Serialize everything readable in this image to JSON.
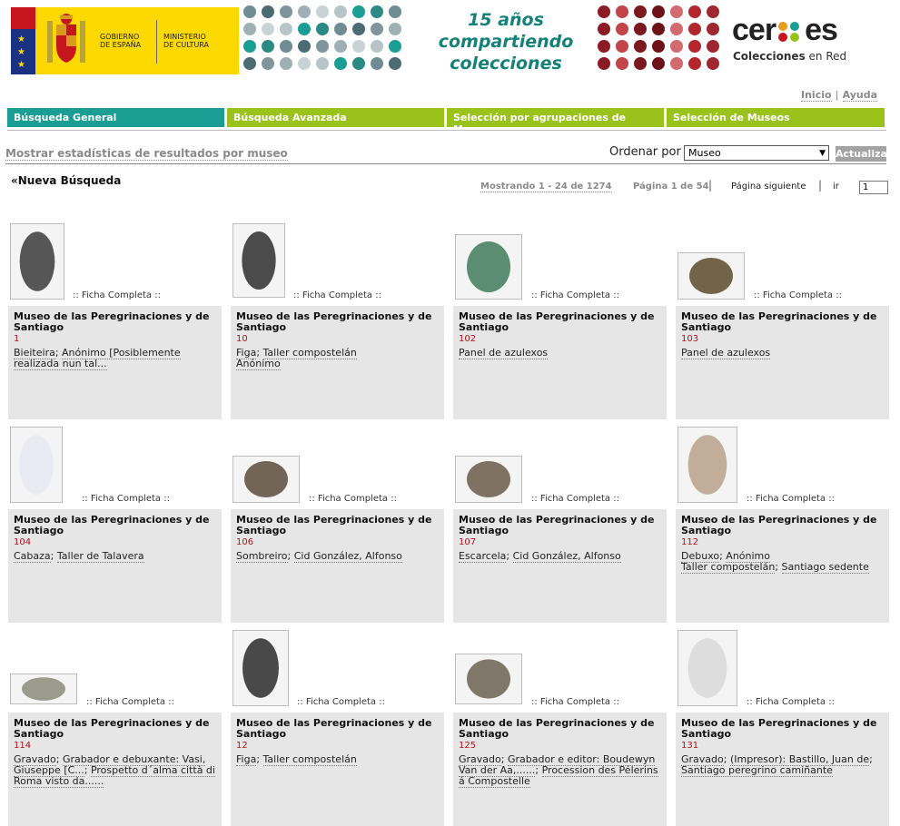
{
  "header": {
    "gov_line1": "Gobierno",
    "gov_line2": "de España",
    "ministry_line1": "Ministerio",
    "ministry_line2": "de Cultura",
    "slogan_line1": "15 años",
    "slogan_line2": "compartiendo",
    "slogan_line3": "colecciones",
    "brand_left": "cer",
    "brand_right": "es",
    "brand_sub_bold": "Colecciones",
    "brand_sub_rest": " en Red"
  },
  "top_links": {
    "home": "Inicio",
    "help": "Ayuda"
  },
  "nav": {
    "general": "Búsqueda General",
    "advanced": "Búsqueda Avanzada",
    "groups": "Selección por agrupaciones de Museos",
    "museums": "Selección de Museos"
  },
  "toolbar": {
    "stats_link": "Mostrar estadísticas de resultados por museo",
    "order_label": "Ordenar por",
    "order_value": "Museo",
    "update_button": "Actualizar",
    "new_search": "«Nueva Búsqueda"
  },
  "pager": {
    "showing": "Mostrando 1 - 24 de 1274",
    "page": "Página 1 de 54",
    "next": "Página siguiente",
    "go": "ir",
    "page_input": "1"
  },
  "ficha_label": ":: Ficha Completa ::",
  "results": [
    {
      "museum": "Museo de las Peregrinaciones y de Santiago",
      "num": "1",
      "desc": [
        [
          "Bieiteira",
          "Anónimo [Posiblemente realizada nun tal..."
        ]
      ]
    },
    {
      "museum": "Museo de las Peregrinaciones y de Santiago",
      "num": "10",
      "desc": [
        [
          "Figa",
          "Taller compostelán"
        ],
        [
          "Anónimo"
        ]
      ]
    },
    {
      "museum": "Museo de las Peregrinaciones y de Santiago",
      "num": "102",
      "desc": [
        [
          "Panel de azulexos"
        ]
      ]
    },
    {
      "museum": "Museo de las Peregrinaciones y de Santiago",
      "num": "103",
      "desc": [
        [
          "Panel de azulexos"
        ]
      ]
    },
    {
      "museum": "Museo de las Peregrinaciones y de Santiago",
      "num": "104",
      "desc": [
        [
          "Cabaza",
          "Taller de Talavera"
        ]
      ]
    },
    {
      "museum": "Museo de las Peregrinaciones y de Santiago",
      "num": "106",
      "desc": [
        [
          "Sombreiro",
          "Cid González, Alfonso"
        ]
      ]
    },
    {
      "museum": "Museo de las Peregrinaciones y de Santiago",
      "num": "107",
      "desc": [
        [
          "Escarcela",
          "Cid González, Alfonso"
        ]
      ]
    },
    {
      "museum": "Museo de las Peregrinaciones y de Santiago",
      "num": "112",
      "desc": [
        [
          "Debuxo",
          "Anónimo"
        ],
        [
          "Taller compostelán",
          "Santiago sedente"
        ]
      ]
    },
    {
      "museum": "Museo de las Peregrinaciones y de Santiago",
      "num": "114",
      "desc": [
        [
          "Gravado",
          "Grabador e debuxante: Vasi, Giuseppe [C...",
          "Prospetto d´alma città di Roma visto da......"
        ]
      ]
    },
    {
      "museum": "Museo de las Peregrinaciones y de Santiago",
      "num": "12",
      "desc": [
        [
          "Figa",
          "Taller compostelán"
        ]
      ]
    },
    {
      "museum": "Museo de las Peregrinaciones y de Santiago",
      "num": "125",
      "desc": [
        [
          "Gravado",
          "Grabador e editor: Boudewyn Van der Aa,......",
          "Procession des Pélerins á Compostelle"
        ]
      ]
    },
    {
      "museum": "Museo de las Peregrinaciones y de Santiago",
      "num": "131",
      "desc": [
        [
          "Gravado",
          "(Impresor): Bastillo, Juan de",
          "Santiago peregrino camiñante"
        ]
      ]
    }
  ]
}
